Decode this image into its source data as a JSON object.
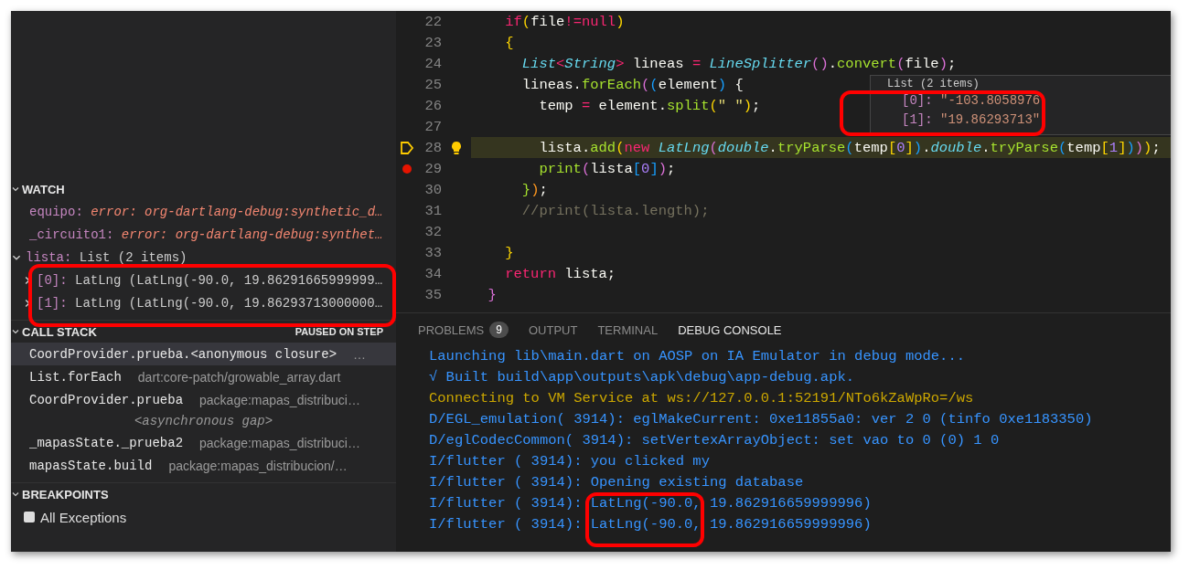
{
  "sidebar": {
    "watch": {
      "title": "WATCH",
      "expanded": true,
      "items": [
        {
          "name": "equipo:",
          "value": "error: org-dartlang-debug:synthetic_d…",
          "kind": "error"
        },
        {
          "name": "_circuito1:",
          "value": "error: org-dartlang-debug:synthet…",
          "kind": "error"
        },
        {
          "name": "lista:",
          "value": "List (2 items)",
          "kind": "object",
          "expanded": true,
          "highlighted": true,
          "children": [
            {
              "name": "[0]:",
              "value": "LatLng (LatLng(-90.0, 19.86291665999999…",
              "expanded": false
            },
            {
              "name": "[1]:",
              "value": "LatLng (LatLng(-90.0, 19.86293713000000…",
              "expanded": false
            }
          ]
        }
      ]
    },
    "call_stack": {
      "title": "CALL STACK",
      "status": "PAUSED ON STEP",
      "frames": [
        {
          "kind": "frame",
          "name": "CoordProvider.prueba.<anonymous closure>",
          "source": "…",
          "selected": true
        },
        {
          "kind": "frame",
          "name": "List.forEach",
          "source": "dart:core-patch/growable_array.dart",
          "selected": false
        },
        {
          "kind": "frame",
          "name": "CoordProvider.prueba",
          "source": "package:mapas_distribuci…",
          "selected": false
        },
        {
          "kind": "gap",
          "name": "<asynchronous gap>"
        },
        {
          "kind": "frame",
          "name": "_mapasState._prueba2",
          "source": "package:mapas_distribuci…",
          "selected": false
        },
        {
          "kind": "frame",
          "name": "mapasState.build",
          "source": "package:mapas_distribucion/…",
          "selected": false
        }
      ]
    },
    "breakpoints": {
      "title": "BREAKPOINTS",
      "items": [
        {
          "label": "All Exceptions",
          "checked": false
        }
      ]
    }
  },
  "editor": {
    "lines": [
      {
        "number": "22",
        "tokens": [
          {
            "kind": "kw",
            "text": "    if"
          },
          {
            "kind": "b1",
            "text": "("
          },
          {
            "kind": "plain",
            "text": "file"
          },
          {
            "kind": "kw",
            "text": "!="
          },
          {
            "kind": "kw",
            "text": "null"
          },
          {
            "kind": "b1",
            "text": ")"
          }
        ]
      },
      {
        "number": "23",
        "tokens": [
          {
            "kind": "b1",
            "text": "    {"
          }
        ]
      },
      {
        "number": "24",
        "tokens": [
          {
            "kind": "type",
            "text": "      List"
          },
          {
            "kind": "kw",
            "text": "<"
          },
          {
            "kind": "type",
            "text": "String"
          },
          {
            "kind": "kw",
            "text": ">"
          },
          {
            "kind": "plain",
            "text": " lineas "
          },
          {
            "kind": "kw",
            "text": "= "
          },
          {
            "kind": "type",
            "text": "LineSplitter"
          },
          {
            "kind": "b2",
            "text": "()"
          },
          {
            "kind": "plain",
            "text": "."
          },
          {
            "kind": "fn",
            "text": "convert"
          },
          {
            "kind": "b2",
            "text": "("
          },
          {
            "kind": "plain",
            "text": "file"
          },
          {
            "kind": "b2",
            "text": ")"
          },
          {
            "kind": "plain",
            "text": ";"
          }
        ]
      },
      {
        "number": "25",
        "tokens": [
          {
            "kind": "plain",
            "text": "      lineas."
          },
          {
            "kind": "fn",
            "text": "forEach"
          },
          {
            "kind": "b2",
            "text": "("
          },
          {
            "kind": "b3",
            "text": "("
          },
          {
            "kind": "plain",
            "text": "element"
          },
          {
            "kind": "b3",
            "text": ")"
          },
          {
            "kind": "plain",
            "text": " {"
          }
        ]
      },
      {
        "number": "26",
        "tokens": [
          {
            "kind": "plain",
            "text": "        temp "
          },
          {
            "kind": "kw",
            "text": "="
          },
          {
            "kind": "plain",
            "text": " element."
          },
          {
            "kind": "fn",
            "text": "split"
          },
          {
            "kind": "b1",
            "text": "("
          },
          {
            "kind": "str",
            "text": "\" \""
          },
          {
            "kind": "b1",
            "text": ")"
          },
          {
            "kind": "plain",
            "text": ";"
          }
        ]
      },
      {
        "number": "27"
      },
      {
        "number": "28",
        "kind": "current",
        "lightbulb": true,
        "tokens": [
          {
            "kind": "plain",
            "text": "        lista."
          },
          {
            "kind": "fn",
            "text": "add"
          },
          {
            "kind": "b1",
            "text": "("
          },
          {
            "kind": "kw",
            "text": "new "
          },
          {
            "kind": "type",
            "text": "LatLng"
          },
          {
            "kind": "b2",
            "text": "("
          },
          {
            "kind": "type",
            "text": "double"
          },
          {
            "kind": "plain",
            "text": "."
          },
          {
            "kind": "fn",
            "text": "tryParse"
          },
          {
            "kind": "b3",
            "text": "("
          },
          {
            "kind": "plain",
            "text": "temp"
          },
          {
            "kind": "b1",
            "text": "["
          },
          {
            "kind": "num",
            "text": "0"
          },
          {
            "kind": "b1",
            "text": "]"
          },
          {
            "kind": "b3",
            "text": ")"
          },
          {
            "kind": "plain",
            "text": "."
          },
          {
            "kind": "type",
            "text": "double"
          },
          {
            "kind": "plain",
            "text": "."
          },
          {
            "kind": "fn",
            "text": "tryParse"
          },
          {
            "kind": "b3",
            "text": "("
          },
          {
            "kind": "plain",
            "text": "temp"
          },
          {
            "kind": "b1",
            "text": "["
          },
          {
            "kind": "num",
            "text": "1"
          },
          {
            "kind": "b1",
            "text": "]"
          },
          {
            "kind": "b3",
            "text": ")"
          },
          {
            "kind": "b2",
            "text": ")"
          },
          {
            "kind": "b1",
            "text": ")"
          },
          {
            "kind": "plain",
            "text": ";"
          }
        ]
      },
      {
        "number": "29",
        "kind": "breakpoint",
        "tokens": [
          {
            "kind": "fn",
            "text": "        print"
          },
          {
            "kind": "b2",
            "text": "("
          },
          {
            "kind": "plain",
            "text": "lista"
          },
          {
            "kind": "b3",
            "text": "["
          },
          {
            "kind": "num",
            "text": "0"
          },
          {
            "kind": "b3",
            "text": "]"
          },
          {
            "kind": "b2",
            "text": ")"
          },
          {
            "kind": "plain",
            "text": ";"
          }
        ]
      },
      {
        "number": "30",
        "tokens": [
          {
            "kind": "fn",
            "text": "      }"
          },
          {
            "kind": "orange",
            "text": ")"
          },
          {
            "kind": "plain",
            "text": ";"
          }
        ]
      },
      {
        "number": "31",
        "tokens": [
          {
            "kind": "comment",
            "text": "      //print(lista.length);"
          }
        ]
      },
      {
        "number": "32"
      },
      {
        "number": "33",
        "tokens": [
          {
            "kind": "b1",
            "text": "    }"
          }
        ]
      },
      {
        "number": "34",
        "tokens": [
          {
            "kind": "kw",
            "text": "    return"
          },
          {
            "kind": "plain",
            "text": " lista;"
          }
        ]
      },
      {
        "number": "35",
        "tokens": [
          {
            "kind": "b2",
            "text": "  }"
          }
        ]
      }
    ],
    "hover": {
      "highlighted": true,
      "title": "List (2 items)",
      "items": [
        {
          "name": "[0]:",
          "value": "\"-103.8058976"
        },
        {
          "name": "[1]:",
          "value": "\"19.86293713\""
        }
      ]
    }
  },
  "panel": {
    "highlighted": true,
    "tabs": [
      {
        "label": "PROBLEMS",
        "badge": "9",
        "selected": false
      },
      {
        "label": "OUTPUT",
        "selected": false
      },
      {
        "label": "TERMINAL",
        "selected": false
      },
      {
        "label": "DEBUG CONSOLE",
        "selected": true
      }
    ],
    "console": [
      {
        "text": "Launching lib\\main.dart on AOSP on IA Emulator in debug mode...",
        "color": "#3794ff"
      },
      {
        "text": "√ Built build\\app\\outputs\\apk\\debug\\app-debug.apk.",
        "color": "#3794ff"
      },
      {
        "text": "Connecting to VM Service at ws://127.0.0.1:52191/NTo6kZaWpRo=/ws",
        "color": "#cca700"
      },
      {
        "text": "D/EGL_emulation( 3914): eglMakeCurrent: 0xe11855a0: ver 2 0 (tinfo 0xe1183350)",
        "color": "#3794ff"
      },
      {
        "text": "D/eglCodecCommon( 3914): setVertexArrayObject: set vao to 0 (0) 1 0",
        "color": "#3794ff"
      },
      {
        "text": "I/flutter ( 3914): you clicked my",
        "color": "#3794ff"
      },
      {
        "text": "I/flutter ( 3914): Opening existing database",
        "color": "#3794ff"
      },
      {
        "text": "I/flutter ( 3914): LatLng(-90.0, 19.862916659999996)",
        "color": "#3794ff"
      },
      {
        "text": "I/flutter ( 3914): LatLng(-90.0, 19.862916659999996)",
        "color": "#3794ff"
      }
    ]
  }
}
